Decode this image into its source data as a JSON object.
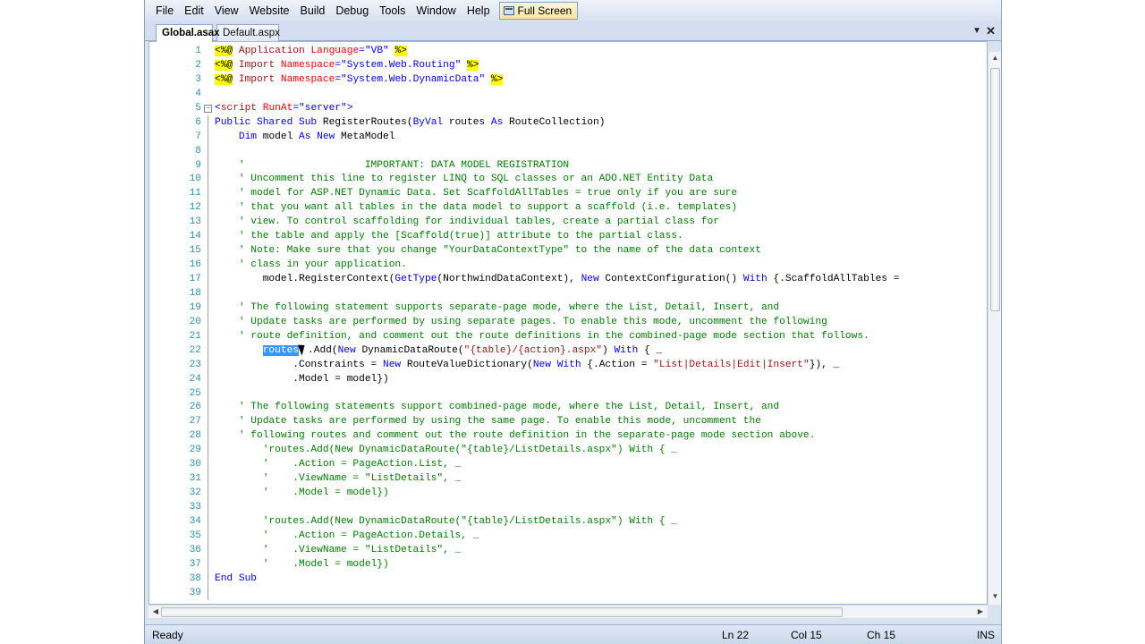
{
  "menu": {
    "items": [
      "File",
      "Edit",
      "View",
      "Website",
      "Build",
      "Debug",
      "Tools",
      "Window",
      "Help"
    ],
    "fullscreen_label": "Full Screen"
  },
  "tabs": {
    "active": "Global.asax",
    "inactive": "Default.aspx",
    "dropdown_glyph": "▼",
    "close_glyph": "✕"
  },
  "editor": {
    "lines": [
      {
        "num": "1",
        "html": "<span class=\"dir\">&lt;%@</span> <span class=\"str\">Application</span> <span class=\"attr\">Language</span><span class=\"kw\">=\"VB\"</span> <span class=\"dir\">%&gt;</span>"
      },
      {
        "num": "2",
        "html": "<span class=\"dir\">&lt;%@</span> <span class=\"str\">Import</span> <span class=\"attr\">Namespace</span><span class=\"kw\">=\"System.Web.Routing\"</span> <span class=\"dir\">%&gt;</span>"
      },
      {
        "num": "3",
        "html": "<span class=\"dir\">&lt;%@</span> <span class=\"str\">Import</span> <span class=\"attr\">Namespace</span><span class=\"kw\">=\"System.Web.DynamicData\"</span> <span class=\"dir\">%&gt;</span>"
      },
      {
        "num": "4",
        "html": ""
      },
      {
        "num": "5",
        "fold": "box",
        "html": "<span class=\"kw\">&lt;</span><span class=\"str\">script</span> <span class=\"attr\">RunAt</span><span class=\"kw\">=\"server\"&gt;</span>"
      },
      {
        "num": "6",
        "fold": "bar",
        "html": "<span class=\"kw\">Public Shared Sub</span> RegisterRoutes(<span class=\"kw\">ByVal</span> routes <span class=\"kw\">As</span> RouteCollection)"
      },
      {
        "num": "7",
        "fold": "bar",
        "html": "    <span class=\"kw\">Dim</span> model <span class=\"kw\">As New</span> MetaModel"
      },
      {
        "num": "8",
        "fold": "bar",
        "html": ""
      },
      {
        "num": "9",
        "fold": "bar",
        "html": "    <span class=\"cm\">'                    IMPORTANT: DATA MODEL REGISTRATION</span>"
      },
      {
        "num": "10",
        "fold": "bar",
        "html": "    <span class=\"cm\">' Uncomment this line to register LINQ to SQL classes or an ADO.NET Entity Data</span>"
      },
      {
        "num": "11",
        "fold": "bar",
        "html": "    <span class=\"cm\">' model for ASP.NET Dynamic Data. Set ScaffoldAllTables = true only if you are sure</span>"
      },
      {
        "num": "12",
        "fold": "bar",
        "html": "    <span class=\"cm\">' that you want all tables in the data model to support a scaffold (i.e. templates)</span>"
      },
      {
        "num": "13",
        "fold": "bar",
        "html": "    <span class=\"cm\">' view. To control scaffolding for individual tables, create a partial class for</span>"
      },
      {
        "num": "14",
        "fold": "bar",
        "html": "    <span class=\"cm\">' the table and apply the [Scaffold(true)] attribute to the partial class.</span>"
      },
      {
        "num": "15",
        "fold": "bar",
        "html": "    <span class=\"cm\">' Note: Make sure that you change \"YourDataContextType\" to the name of the data context</span>"
      },
      {
        "num": "16",
        "fold": "bar",
        "html": "    <span class=\"cm\">' class in your application.</span>"
      },
      {
        "num": "17",
        "fold": "bar",
        "html": "        model.RegisterContext(<span class=\"kw\">GetType</span>(NorthwindDataContext), <span class=\"kw\">New</span> ContextConfiguration() <span class=\"kw\">With</span> {.ScaffoldAllTables = "
      },
      {
        "num": "18",
        "fold": "bar",
        "html": ""
      },
      {
        "num": "19",
        "fold": "bar",
        "html": "    <span class=\"cm\">' The following statement supports separate-page mode, where the List, Detail, Insert, and</span>"
      },
      {
        "num": "20",
        "fold": "bar",
        "html": "    <span class=\"cm\">' Update tasks are performed by using separate pages. To enable this mode, uncomment the following</span>"
      },
      {
        "num": "21",
        "fold": "bar",
        "html": "    <span class=\"cm\">' route definition, and comment out the route definitions in the combined-page mode section that follows.</span>"
      },
      {
        "num": "22",
        "fold": "bar",
        "html": "        <span class=\"sel\">routes</span><span class=\"cursor\"></span>.Add(<span class=\"kw\">New</span> DynamicDataRoute(<span class=\"str\">\"{table}/{action}.aspx\"</span>) <span class=\"kw\">With</span> { _"
      },
      {
        "num": "23",
        "fold": "bar",
        "html": "             .Constraints = <span class=\"kw\">New</span> RouteValueDictionary(<span class=\"kw\">New With</span> {.Action = <span class=\"str\">\"List|Details|Edit|Insert\"</span>}), _"
      },
      {
        "num": "24",
        "fold": "bar",
        "html": "             .Model = model})"
      },
      {
        "num": "25",
        "fold": "bar",
        "html": ""
      },
      {
        "num": "26",
        "fold": "bar",
        "html": "    <span class=\"cm\">' The following statements support combined-page mode, where the List, Detail, Insert, and</span>"
      },
      {
        "num": "27",
        "fold": "bar",
        "html": "    <span class=\"cm\">' Update tasks are performed by using the same page. To enable this mode, uncomment the</span>"
      },
      {
        "num": "28",
        "fold": "bar",
        "html": "    <span class=\"cm\">' following routes and comment out the route definition in the separate-page mode section above.</span>"
      },
      {
        "num": "29",
        "fold": "bar",
        "html": "        <span class=\"cm\">'routes.Add(New DynamicDataRoute(\"{table}/ListDetails.aspx\") With { _</span>"
      },
      {
        "num": "30",
        "fold": "bar",
        "html": "        <span class=\"cm\">'    .Action = PageAction.List, _</span>"
      },
      {
        "num": "31",
        "fold": "bar",
        "html": "        <span class=\"cm\">'    .ViewName = \"ListDetails\", _</span>"
      },
      {
        "num": "32",
        "fold": "bar",
        "html": "        <span class=\"cm\">'    .Model = model})</span>"
      },
      {
        "num": "33",
        "fold": "bar",
        "html": ""
      },
      {
        "num": "34",
        "fold": "bar",
        "html": "        <span class=\"cm\">'routes.Add(New DynamicDataRoute(\"{table}/ListDetails.aspx\") With { _</span>"
      },
      {
        "num": "35",
        "fold": "bar",
        "html": "        <span class=\"cm\">'    .Action = PageAction.Details, _</span>"
      },
      {
        "num": "36",
        "fold": "bar",
        "html": "        <span class=\"cm\">'    .ViewName = \"ListDetails\", _</span>"
      },
      {
        "num": "37",
        "fold": "bar",
        "html": "        <span class=\"cm\">'    .Model = model})</span>"
      },
      {
        "num": "38",
        "fold": "bar",
        "html": "<span class=\"kw\">End Sub</span>"
      },
      {
        "num": "39",
        "fold": "bar",
        "html": ""
      }
    ]
  },
  "statusbar": {
    "ready": "Ready",
    "ln": "Ln 22",
    "col": "Col 15",
    "ch": "Ch 15",
    "mode": "INS"
  },
  "scroll": {
    "vertical_position": 0.0,
    "horizontal_position": 0.0
  }
}
